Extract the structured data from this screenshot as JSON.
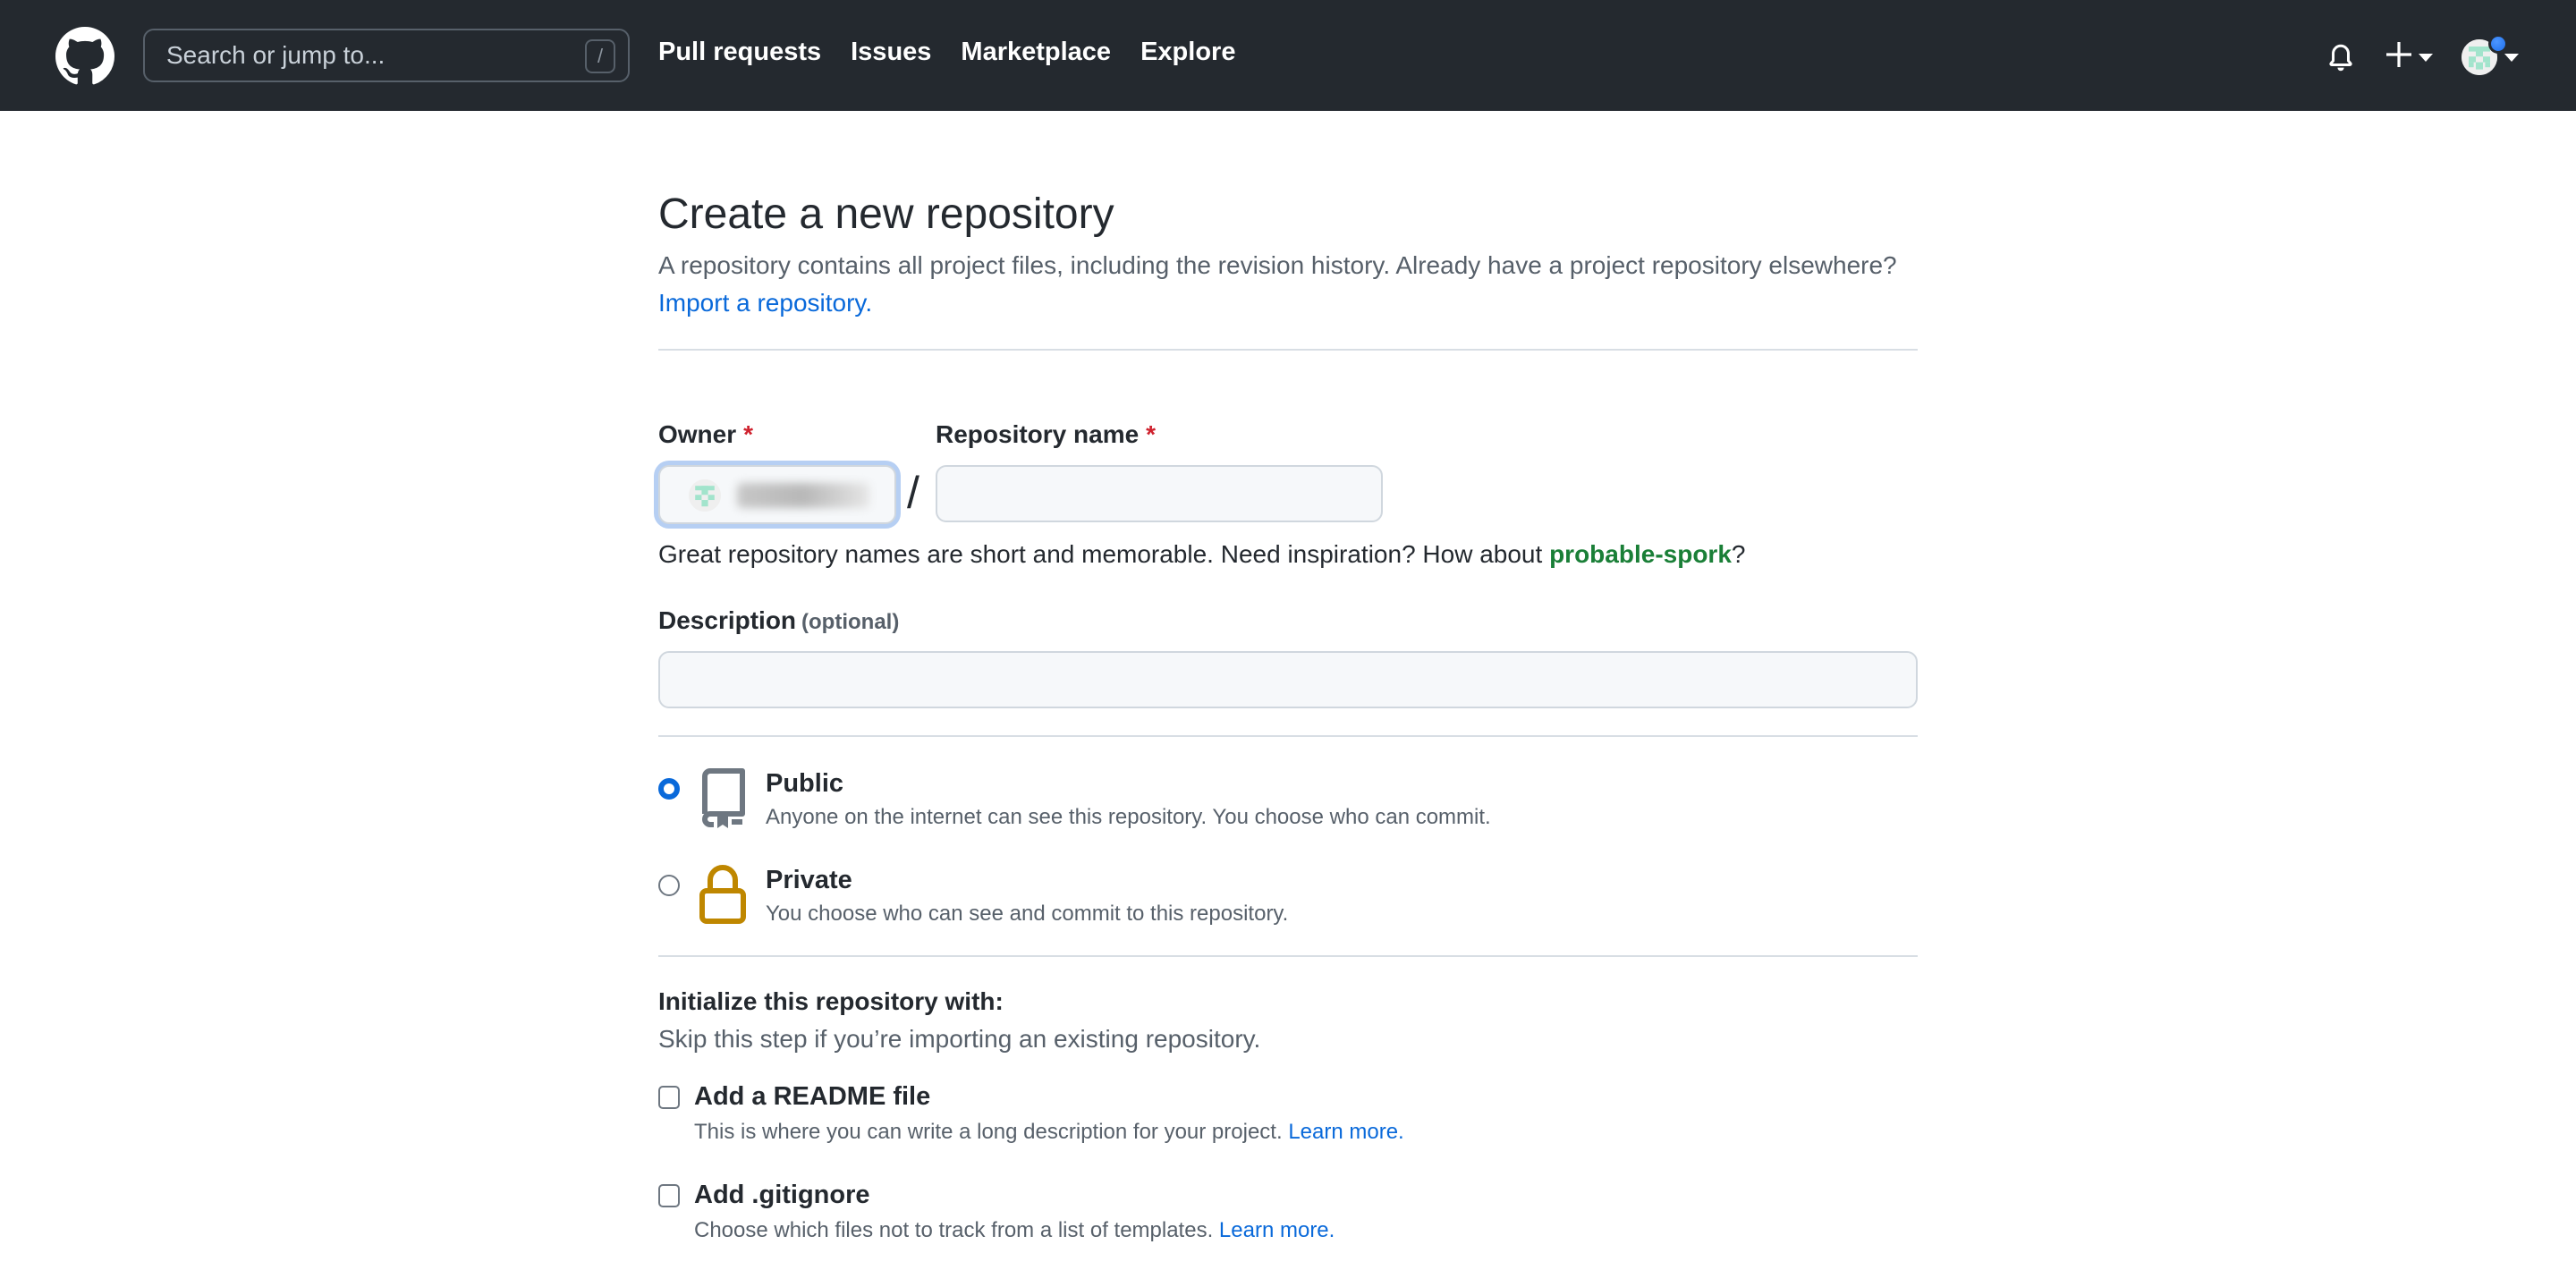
{
  "header": {
    "search": {
      "placeholder": "Search or jump to...",
      "shortcut": "/"
    },
    "nav": [
      {
        "label": "Pull requests"
      },
      {
        "label": "Issues"
      },
      {
        "label": "Marketplace"
      },
      {
        "label": "Explore"
      }
    ],
    "icons": {
      "logo": "github-logo-icon",
      "notifications": "bell-icon",
      "create": "plus-icon",
      "profile": "avatar"
    }
  },
  "page": {
    "title": "Create a new repository",
    "subtitle_text": "A repository contains all project files, including the revision history. Already have a project repository elsewhere?",
    "import_link": "Import a repository."
  },
  "form": {
    "owner": {
      "label": "Owner",
      "required_mark": "*",
      "value_hidden": true
    },
    "separator": "/",
    "repo_name": {
      "label": "Repository name",
      "required_mark": "*",
      "value": "",
      "placeholder": ""
    },
    "hint": {
      "text": "Great repository names are short and memorable. Need inspiration? How about",
      "suggestion": "probable-spork",
      "suffix": "?"
    },
    "description": {
      "label": "Description",
      "optional": "(optional)",
      "value": ""
    },
    "visibility": {
      "selected": "public",
      "options": [
        {
          "id": "public",
          "title": "Public",
          "description": "Anyone on the internet can see this repository. You choose who can commit.",
          "icon": "repo-icon"
        },
        {
          "id": "private",
          "title": "Private",
          "description": "You choose who can see and commit to this repository.",
          "icon": "lock-icon"
        }
      ]
    },
    "initialize": {
      "title": "Initialize this repository with:",
      "subtitle": "Skip this step if you’re importing an existing repository.",
      "options": [
        {
          "title": "Add a README file",
          "description": "This is where you can write a long description for your project.",
          "link": "Learn more.",
          "checked": false
        },
        {
          "title": "Add .gitignore",
          "description": "Choose which files not to track from a list of templates.",
          "link": "Learn more.",
          "checked": false
        }
      ]
    }
  },
  "colors": {
    "header_bg": "#24292f",
    "link": "#0969da",
    "suggestion": "#1a7f37",
    "required": "#cf222e",
    "lock": "#bf8700",
    "focus_ring": "#b6cff3"
  }
}
